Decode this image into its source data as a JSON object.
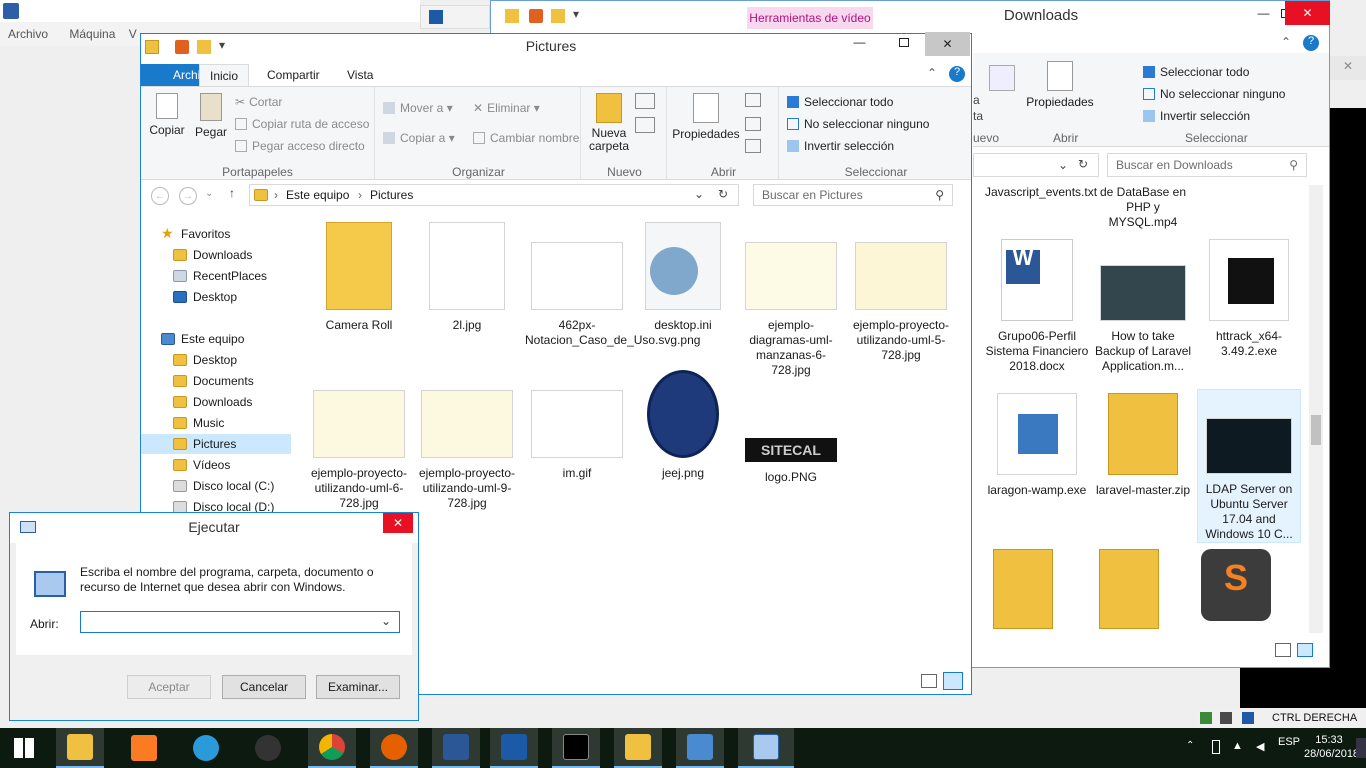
{
  "vbox": {
    "menu": [
      "Archivo",
      "Máquina",
      "V"
    ]
  },
  "downloads": {
    "title": "Downloads",
    "context_tab": "Herramientas de vídeo",
    "ribbon": {
      "propiedades": "Propiedades",
      "abrir_group": "Abrir",
      "select_all": "Seleccionar todo",
      "select_none": "No seleccionar ninguno",
      "invert": "Invertir selección",
      "select_group": "Seleccionar",
      "cut_a": "a",
      "cut_ta": "ta",
      "cut_nuevo": "uevo"
    },
    "search_placeholder": "Buscar en Downloads",
    "files": [
      "Javascript_events.txt",
      "de DataBase en PHP y MYSQL.mp4",
      "Grupo06-Perfil Sistema Financiero 2018.docx",
      "How to take Backup of Laravel Application.m...",
      "httrack_x64-3.49.2.exe",
      "laragon-wamp.exe",
      "laravel-master.zip",
      "LDAP Server on Ubuntu Server 17.04 and Windows 10 C..."
    ]
  },
  "pictures": {
    "title": "Pictures",
    "tabs": [
      "Archivo",
      "Inicio",
      "Compartir",
      "Vista"
    ],
    "ribbon": {
      "copiar": "Copiar",
      "pegar": "Pegar",
      "cortar": "Cortar",
      "copiar_ruta": "Copiar ruta de acceso",
      "pegar_acceso": "Pegar acceso directo",
      "portapapeles": "Portapapeles",
      "mover_a": "Mover a",
      "copiar_a": "Copiar a",
      "eliminar": "Eliminar",
      "cambiar_nombre": "Cambiar nombre",
      "organizar": "Organizar",
      "nueva_carpeta": "Nueva carpeta",
      "nuevo": "Nuevo",
      "propiedades": "Propiedades",
      "abrir": "Abrir",
      "select_all": "Seleccionar todo",
      "select_none": "No seleccionar ninguno",
      "invert": "Invertir selección",
      "seleccionar": "Seleccionar"
    },
    "breadcrumb": [
      "Este equipo",
      "Pictures"
    ],
    "search_placeholder": "Buscar en Pictures",
    "nav": {
      "favoritos": "Favoritos",
      "fav_items": [
        "Downloads",
        "RecentPlaces",
        "Desktop"
      ],
      "este_equipo": "Este equipo",
      "pc_items": [
        "Desktop",
        "Documents",
        "Downloads",
        "Music",
        "Pictures",
        "Vídeos",
        "Disco local (C:)",
        "Disco local (D:)"
      ]
    },
    "files": [
      "Camera Roll",
      "2l.jpg",
      "462px-Notacion_Caso_de_Uso.svg.png",
      "desktop.ini",
      "ejemplo-diagramas-uml-manzanas-6-728.jpg",
      "ejemplo-proyecto-utilizando-uml-5-728.jpg",
      "ejemplo-proyecto-utilizando-uml-6-728.jpg",
      "ejemplo-proyecto-utilizando-uml-9-728.jpg",
      "im.gif",
      "jeej.png",
      "logo.PNG"
    ],
    "logo_text": "SITECAL"
  },
  "run": {
    "title": "Ejecutar",
    "description": "Escriba el nombre del programa, carpeta, documento o recurso de Internet que desea abrir con Windows.",
    "open_label": "Abrir:",
    "open_value": "",
    "accept": "Aceptar",
    "cancel": "Cancelar",
    "browse": "Examinar..."
  },
  "taskbar": {
    "time": "15:33",
    "date": "28/06/2018",
    "ctrl_label": "CTRL DERECHA"
  }
}
